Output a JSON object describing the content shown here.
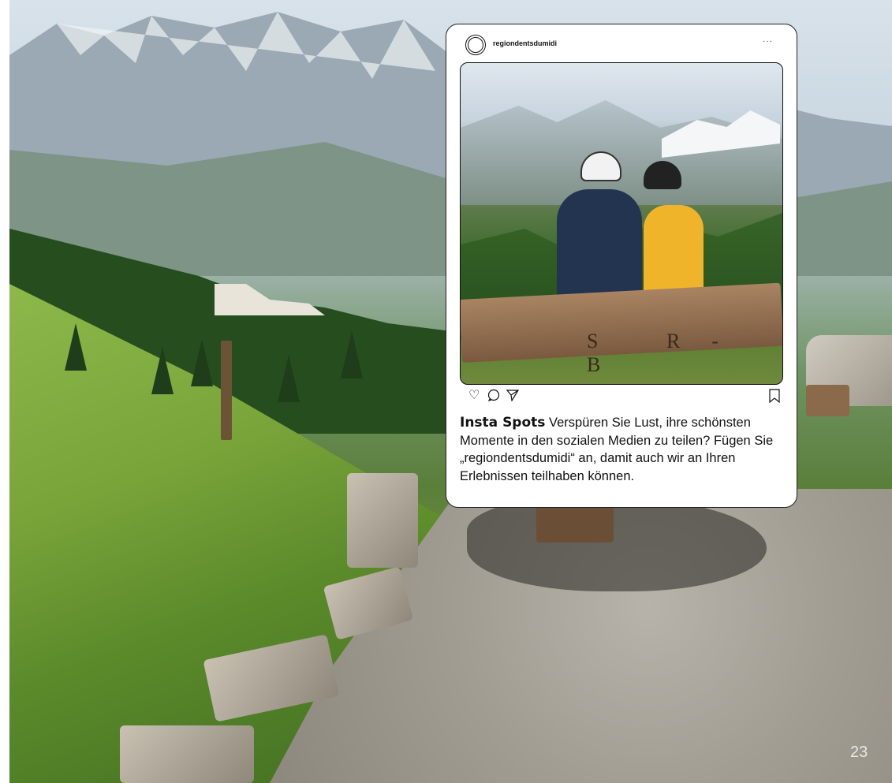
{
  "page": {
    "number": "23"
  },
  "instagram_post": {
    "username": "regiondentsdumidi",
    "more_label": "···",
    "photo_carving": [
      "S",
      "R-B"
    ],
    "icons": {
      "like": "heart-icon",
      "comment": "comment-icon",
      "share": "send-icon",
      "save": "bookmark-icon"
    },
    "caption_title": "Insta Spots",
    "caption_text": "Verspüren Sie Lust, ihre schönsten Momente in den sozialen Medien zu teilen? Fügen Sie „regiondentsdumidi“ an, damit auch wir an Ihren Erlebnissen teilhaben können."
  }
}
